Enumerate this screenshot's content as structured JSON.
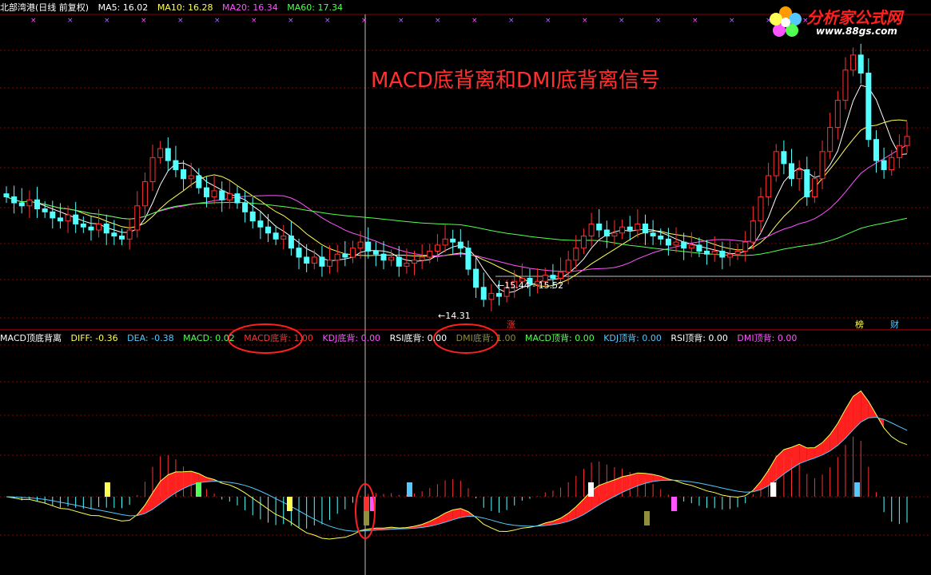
{
  "header": {
    "stock": "北部湾港(日线 前复权)",
    "ma5": "MA5: 16.02",
    "ma10": "MA10: 16.28",
    "ma20": "MA20: 16.34",
    "ma60": "MA60: 17.34"
  },
  "title": "MACD底背离和DMI底背离信号",
  "logo": {
    "name": "分析家公式网",
    "url": "www.88gs.com"
  },
  "price_labels": {
    "low": "14.31",
    "range": "15.44 - 15.52",
    "zhang": "涨",
    "bang": "榜",
    "cai": "财"
  },
  "indicator": {
    "name": "MACD顶底背离",
    "diff": "DIFF: -0.36",
    "dea": "DEA: -0.38",
    "macd": "MACD: 0.02",
    "macd_bottom": "MACD底背: 1.00",
    "kdj_bottom": "KDJ底背: 0.00",
    "rsi_bottom": "RSI底背: 0.00",
    "dmi_bottom": "DMI底背: 1.00",
    "macd_top": "MACD顶背: 0.00",
    "kdj_top": "KDJ顶背: 0.00",
    "rsi_top": "RSI顶背: 0.00",
    "dmi_top": "DMI顶背: 0.00"
  },
  "colors": {
    "up": "#ff3030",
    "down": "#54ffff",
    "ma5": "#ffffff",
    "ma10": "#ffff54",
    "ma20": "#ff54ff",
    "ma60": "#54ff54",
    "grid": "#8b0000",
    "diff": "#ffff54",
    "dea": "#54c8ff"
  },
  "chart_data": {
    "type": "candlestick",
    "price_closes": [
      16.3,
      16.1,
      16.0,
      16.2,
      15.9,
      15.8,
      15.6,
      15.5,
      15.7,
      15.4,
      15.3,
      15.2,
      15.4,
      15.1,
      15.0,
      14.9,
      15.2,
      16.0,
      16.8,
      17.6,
      17.9,
      17.5,
      17.2,
      16.9,
      17.0,
      16.6,
      16.3,
      16.5,
      16.2,
      16.4,
      16.1,
      15.8,
      15.5,
      15.3,
      15.1,
      14.9,
      15.0,
      14.6,
      14.3,
      14.1,
      14.3,
      14.0,
      14.2,
      14.4,
      14.3,
      14.6,
      14.8,
      14.5,
      14.4,
      14.2,
      14.3,
      14.0,
      14.1,
      14.2,
      14.3,
      14.5,
      14.7,
      14.9,
      14.8,
      14.6,
      13.9,
      13.3,
      12.9,
      13.1,
      13.0,
      13.3,
      13.5,
      13.6,
      13.4,
      13.5,
      13.7,
      13.6,
      13.8,
      14.2,
      14.6,
      15.0,
      15.4,
      15.2,
      15.0,
      15.1,
      15.3,
      15.2,
      15.4,
      15.1,
      15.0,
      14.9,
      14.7,
      14.8,
      14.6,
      14.7,
      14.5,
      14.4,
      14.5,
      14.3,
      14.4,
      14.5,
      14.8,
      15.5,
      16.3,
      17.0,
      17.8,
      17.4,
      16.9,
      17.2,
      16.3,
      16.9,
      17.8,
      18.6,
      19.5,
      20.5,
      21.0,
      20.4,
      18.2,
      17.5,
      17.2,
      17.6,
      18.0,
      18.3
    ],
    "low_marker": 14.31,
    "range_marker": [
      15.44,
      15.52
    ],
    "macd_bottom_divergence": 1.0,
    "dmi_bottom_divergence": 1.0
  }
}
